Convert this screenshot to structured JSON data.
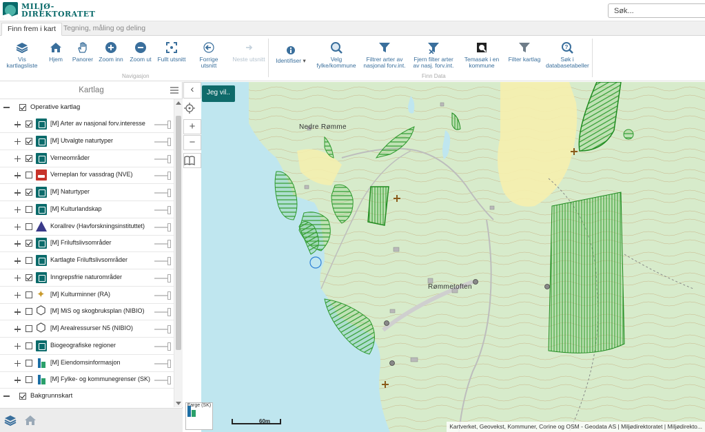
{
  "header": {
    "logo_text": "MILJØ-\nDIREKTORATET",
    "logo_line1": "MILJØ-",
    "logo_line2": "DIREKTORATET",
    "search_placeholder": "Søk..."
  },
  "tabs": [
    {
      "label": "Finn frem i kart",
      "active": true
    },
    {
      "label": "Tegning, måling og deling",
      "active": false
    }
  ],
  "ribbon": {
    "navigation_label": "Navigasjon",
    "finn_data_label": "Finn Data",
    "navigation": [
      {
        "label": "Vis kartlagsliste",
        "icon": "layers-icon"
      },
      {
        "label": "Hjem",
        "icon": "home-icon"
      },
      {
        "label": "Panorer",
        "icon": "hand-icon"
      },
      {
        "label": "Zoom inn",
        "icon": "zoom-in-icon"
      },
      {
        "label": "Zoom ut",
        "icon": "zoom-out-icon"
      },
      {
        "label": "Fullt utsnitt",
        "icon": "full-extent-icon"
      },
      {
        "label": "Forrige utsnitt",
        "icon": "previous-extent-icon"
      },
      {
        "label": "Neste utsnitt",
        "icon": "next-extent-icon",
        "disabled": true
      }
    ],
    "identify_label": "Identifiser",
    "finn_data": [
      {
        "label": "Velg fylke/kommune",
        "icon": "search-map-icon"
      },
      {
        "label": "Filtrer arter av nasjonal forv.int.",
        "icon": "filter-icon"
      },
      {
        "label": "Fjern filter arter av nasj. forv.int.",
        "icon": "remove-filter-icon"
      },
      {
        "label": "Temasøk i en kommune",
        "icon": "theme-search-icon"
      },
      {
        "label": "Filter kartlag",
        "icon": "filter-layer-icon"
      },
      {
        "label": "Søk i databasetabeller",
        "icon": "database-search-icon"
      }
    ]
  },
  "panel": {
    "title": "Kartlag",
    "group_operative": "Operative kartlag",
    "group_background": "Bakgrunnskart",
    "layers": [
      {
        "label": "[M] Arter av nasjonal forv.interesse",
        "checked": true,
        "icon": "teal"
      },
      {
        "label": "[M] Utvalgte naturtyper",
        "checked": true,
        "icon": "teal"
      },
      {
        "label": "Verneområder",
        "checked": true,
        "icon": "teal"
      },
      {
        "label": "Verneplan for vassdrag (NVE)",
        "checked": false,
        "icon": "red"
      },
      {
        "label": "[M] Naturtyper",
        "checked": true,
        "icon": "teal"
      },
      {
        "label": "[M] Kulturlandskap",
        "checked": false,
        "icon": "teal"
      },
      {
        "label": "Korallrev (Havforskningsinstituttet)",
        "checked": false,
        "icon": "tri"
      },
      {
        "label": "[M] Friluftslivsområder",
        "checked": true,
        "icon": "teal"
      },
      {
        "label": "Kartlagte Friluftslivsområder",
        "checked": false,
        "icon": "teal"
      },
      {
        "label": "Inngrepsfrie naturområder",
        "checked": true,
        "icon": "teal"
      },
      {
        "label": "[M] Kulturminner (RA)",
        "checked": false,
        "icon": "star"
      },
      {
        "label": "[M] MiS og skogbruksplan (NIBIO)",
        "checked": false,
        "icon": "cube"
      },
      {
        "label": "[M] Arealressurser N5 (NIBIO)",
        "checked": false,
        "icon": "cube"
      },
      {
        "label": "Biogeografiske regioner",
        "checked": false,
        "icon": "teal"
      },
      {
        "label": "[M] Eiendomsinformasjon",
        "checked": false,
        "icon": "flag"
      },
      {
        "label": "[M] Fylke- og kommunegrenser (SK)",
        "checked": false,
        "icon": "flag"
      }
    ]
  },
  "map": {
    "jeg_vil_label": "Jeg vil..",
    "place_names": [
      "Nedre Rømme",
      "Rømmetoften"
    ],
    "scale_label": "60m",
    "basemap_label": "Farge (SK)",
    "attribution": "Kartverket, Geovekst, Kommuner, Corine og OSM - Geodata AS | Miljødirektoratet | Miljødirekto..."
  },
  "colors": {
    "brand_teal": "#0f6b6b",
    "water": "#bfe6ef",
    "land": "#d9eccf",
    "hatch_green": "#2e9a2e"
  }
}
